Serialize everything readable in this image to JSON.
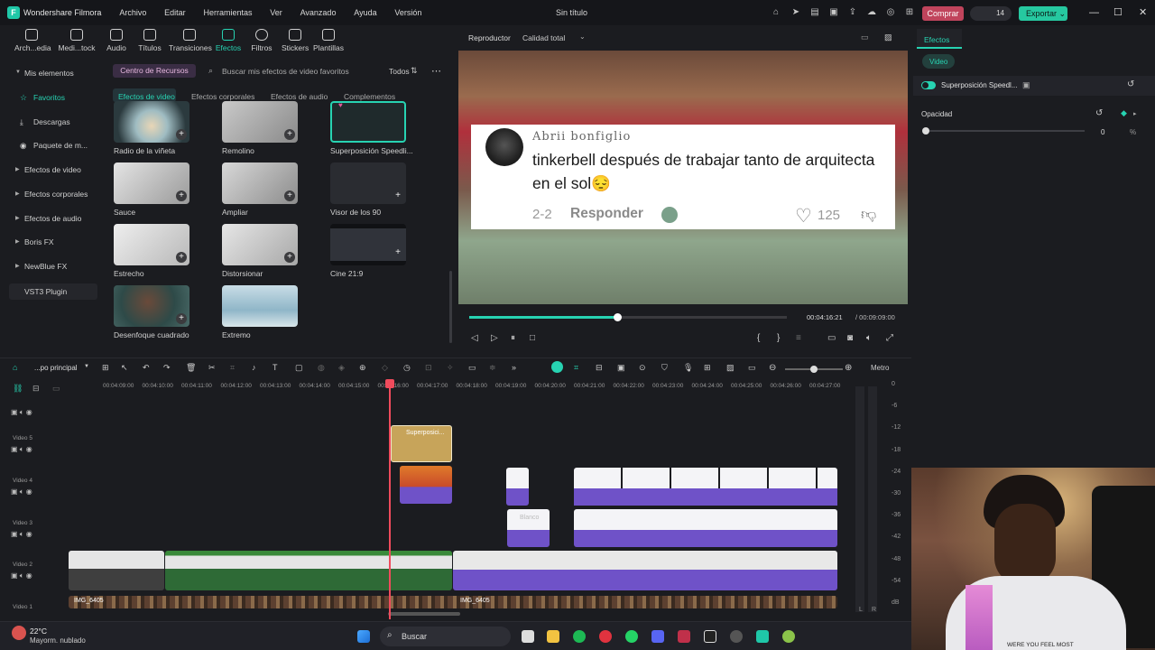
{
  "titlebar": {
    "app_name": "Wondershare Filmora",
    "menus": [
      "Archivo",
      "Editar",
      "Herramientas",
      "Ver",
      "Avanzado",
      "Ayuda",
      "Versión"
    ],
    "doc_title": "Sin título",
    "buy_label": "Comprar",
    "credits": "14",
    "export_label": "Exportar"
  },
  "toolbar": {
    "items": [
      "Arch...edia",
      "Medi...tock",
      "Audio",
      "Títulos",
      "Transiciones",
      "Efectos",
      "Filtros",
      "Stickers",
      "Plantillas"
    ],
    "active": "Efectos"
  },
  "library": {
    "nav": [
      "Mis elementos",
      "Favoritos",
      "Descargas",
      "Paquete de m...",
      "Efectos de video",
      "Efectos corporales",
      "Efectos de audio",
      "Boris FX",
      "NewBlue FX",
      "VST3 Plugin"
    ],
    "resource_center": "Centro de Recursos",
    "search_placeholder": "Buscar mis efectos de video favoritos",
    "filter": "Todos",
    "tabs": [
      "Efectos de video",
      "Efectos corporales",
      "Efectos de audio",
      "Complementos"
    ],
    "effects": [
      "Radio de la viñeta",
      "Remolino",
      "Superposición Speedli...",
      "Sauce",
      "Ampliar",
      "Visor de los 90",
      "Estrecho",
      "Distorsionar",
      "Cine 21:9",
      "Desenfoque cuadrado",
      "Extremo"
    ]
  },
  "player": {
    "label": "Reproductor",
    "quality": "Calidad total",
    "current_time": "00:04:16:21",
    "total_time": "/ 00:09:09:00",
    "progress": 0.466
  },
  "comment": {
    "user": "Abrii bonfiglio",
    "text": "tinkerbell después de trabajar tanto de arquitecta en el sol😔",
    "date": "2-2",
    "reply": "Responder",
    "likes": "125"
  },
  "properties": {
    "tab": "Efectos",
    "subtab": "Video",
    "effect_name": "Superposición Speedl...",
    "opacity_label": "Opacidad",
    "opacity_value": "0",
    "opacity_unit": "%"
  },
  "timeline": {
    "project": "...po principal",
    "zoom_label": "Metro",
    "ruler": [
      "00:04:09:00",
      "00:04:10:00",
      "00:04:11:00",
      "00:04:12:00",
      "00:04:13:00",
      "00:04:14:00",
      "00:04:15:00",
      "00:04:16:00",
      "00:04:17:00",
      "00:04:18:00",
      "00:04:19:00",
      "00:04:20:00",
      "00:04:21:00",
      "00:04:22:00",
      "00:04:23:00",
      "00:04:24:00",
      "00:04:25:00",
      "00:04:26:00",
      "00:04:27:00"
    ],
    "tracks": [
      "Video 5",
      "Video 4",
      "Video 3",
      "Video 2",
      "Video 1"
    ],
    "clip_effect": "Superposici...",
    "clip_video1": "IMG_6405",
    "clip_blanco": "Blanco",
    "meter": [
      "0",
      "-6",
      "-12",
      "-18",
      "-24",
      "-30",
      "-36",
      "-42",
      "-48",
      "-54",
      "dB"
    ],
    "meter_lr": [
      "L",
      "R"
    ]
  },
  "taskbar": {
    "temp": "22°C",
    "weather": "Mayorm. nublado",
    "search": "Buscar"
  },
  "webcam": {
    "shirt_text": "WERE YOU FEEL MOST"
  },
  "colors": {
    "accent": "#27d3b2",
    "buy": "#c0445c",
    "playhead": "#f04b5c",
    "clip_purple": "#6f52c8",
    "clip_gold": "#c7a45a"
  }
}
